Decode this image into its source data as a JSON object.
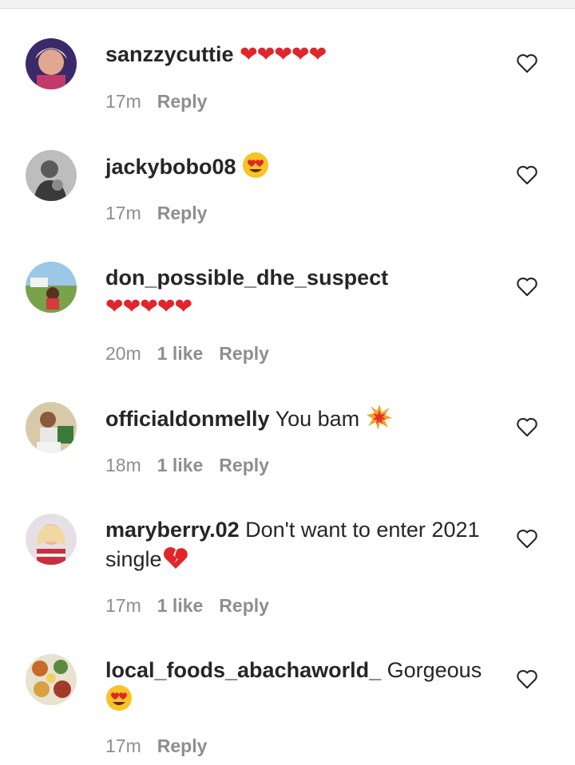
{
  "comments": [
    {
      "username": "sanzzycuttie",
      "text": "❤❤❤❤❤",
      "emoji": "",
      "time": "17m",
      "likes": "",
      "reply_label": "Reply"
    },
    {
      "username": "jackybobo08",
      "text": "",
      "emoji": "heart-eyes",
      "time": "17m",
      "likes": "",
      "reply_label": "Reply"
    },
    {
      "username": "don_possible_dhe_suspect",
      "text": "❤❤❤❤❤",
      "emoji": "",
      "time": "20m",
      "likes": "1 like",
      "reply_label": "Reply"
    },
    {
      "username": "officialdonmelly",
      "text": "You bam",
      "emoji": "collision",
      "time": "18m",
      "likes": "1 like",
      "reply_label": "Reply"
    },
    {
      "username": "maryberry.02",
      "text": "Don't want to enter 2021 single",
      "emoji": "broken-heart",
      "time": "17m",
      "likes": "1 like",
      "reply_label": "Reply"
    },
    {
      "username": "local_foods_abachaworld_",
      "text": "Gorgeous",
      "emoji": "heart-eyes",
      "time": "17m",
      "likes": "",
      "reply_label": "Reply"
    }
  ],
  "colors": {
    "text": "#262626",
    "meta": "#8e8e8e",
    "heart_red": "#e0262b",
    "emoji_yellow": "#f7c325"
  }
}
